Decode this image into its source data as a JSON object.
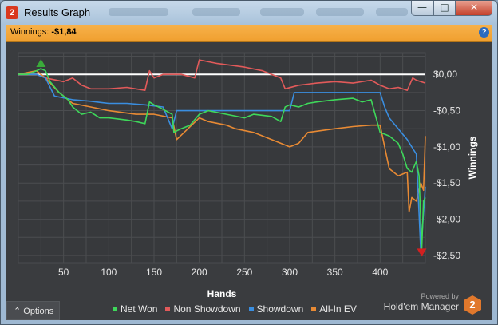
{
  "window": {
    "title": "Results Graph",
    "app_icon": "2",
    "controls": {
      "minimize": "—",
      "maximize": "□",
      "close": "✕"
    }
  },
  "winnings": {
    "label": "Winnings:",
    "value": "-$1,84",
    "help": "?"
  },
  "options": {
    "label": "Options",
    "arrow": "⌃"
  },
  "branding": {
    "powered_by": "Powered by",
    "name": "Hold'em Manager",
    "logo": "2"
  },
  "colors": {
    "net_won": "#3ed85a",
    "non_showdown": "#e25a5a",
    "showdown": "#3a8ee0",
    "allin_ev": "#e88a34",
    "zero_line": "#ffffff"
  },
  "chart_data": {
    "type": "line",
    "xlabel": "Hands",
    "ylabel": "Winnings",
    "xlim": [
      0,
      450
    ],
    "ylim": [
      -2.6,
      0.3
    ],
    "x_ticks": [
      "50",
      "100",
      "150",
      "200",
      "250",
      "300",
      "350",
      "400"
    ],
    "x_tick_values": [
      50,
      100,
      150,
      200,
      250,
      300,
      350,
      400
    ],
    "y_ticks": [
      "$0,00",
      "-$0,50",
      "-$1,00",
      "-$1,50",
      "-$2,00",
      "-$2,50"
    ],
    "y_tick_values": [
      0,
      -0.5,
      -1,
      -1.5,
      -2,
      -2.5
    ],
    "grid": true,
    "legend_position": "bottom",
    "series": [
      {
        "name": "Net Won",
        "color_key": "net_won",
        "x": [
          0,
          10,
          20,
          25,
          30,
          35,
          45,
          55,
          60,
          70,
          80,
          90,
          100,
          120,
          130,
          140,
          145,
          150,
          155,
          170,
          172,
          175,
          180,
          190,
          200,
          210,
          230,
          250,
          260,
          280,
          290,
          295,
          300,
          310,
          320,
          330,
          350,
          370,
          380,
          390,
          400,
          410,
          420,
          425,
          430,
          435,
          440,
          443,
          446,
          448,
          450
        ],
        "y": [
          0,
          0,
          0.05,
          0.08,
          0.05,
          -0.1,
          -0.25,
          -0.35,
          -0.45,
          -0.55,
          -0.52,
          -0.6,
          -0.6,
          -0.63,
          -0.65,
          -0.68,
          -0.38,
          -0.42,
          -0.45,
          -0.55,
          -0.8,
          -0.78,
          -0.75,
          -0.7,
          -0.55,
          -0.5,
          -0.55,
          -0.6,
          -0.55,
          -0.58,
          -0.65,
          -0.45,
          -0.42,
          -0.45,
          -0.4,
          -0.38,
          -0.35,
          -0.33,
          -0.38,
          -0.35,
          -0.8,
          -0.85,
          -0.95,
          -1.1,
          -1.3,
          -1.35,
          -1.2,
          -1.4,
          -2.4,
          -1.75,
          -1.7
        ]
      },
      {
        "name": "Non Showdown",
        "color_key": "non_showdown",
        "x": [
          0,
          20,
          30,
          50,
          60,
          70,
          80,
          100,
          120,
          140,
          145,
          150,
          160,
          180,
          195,
          200,
          220,
          250,
          270,
          290,
          295,
          310,
          330,
          350,
          370,
          390,
          400,
          410,
          420,
          430,
          436,
          440,
          445,
          450
        ],
        "y": [
          0,
          0,
          -0.05,
          -0.1,
          -0.05,
          -0.15,
          -0.2,
          -0.2,
          -0.18,
          -0.22,
          0.05,
          -0.05,
          0,
          0,
          -0.05,
          0.2,
          0.15,
          0.1,
          0.05,
          -0.05,
          -0.2,
          -0.15,
          -0.12,
          -0.1,
          -0.12,
          -0.08,
          -0.15,
          -0.2,
          -0.18,
          -0.22,
          -0.05,
          -0.08,
          -0.1,
          -0.12
        ]
      },
      {
        "name": "Showdown",
        "color_key": "showdown",
        "x": [
          0,
          20,
          30,
          40,
          60,
          80,
          100,
          120,
          140,
          160,
          170,
          175,
          200,
          220,
          250,
          280,
          300,
          305,
          320,
          350,
          380,
          400,
          405,
          410,
          420,
          430,
          440,
          445,
          450
        ],
        "y": [
          0,
          0,
          -0.05,
          -0.3,
          -0.35,
          -0.37,
          -0.4,
          -0.4,
          -0.42,
          -0.45,
          -0.75,
          -0.5,
          -0.5,
          -0.5,
          -0.5,
          -0.5,
          -0.5,
          -0.25,
          -0.25,
          -0.25,
          -0.25,
          -0.25,
          -0.45,
          -0.6,
          -0.75,
          -0.9,
          -1.1,
          -2.45,
          -1.55
        ]
      },
      {
        "name": "All-In EV",
        "color_key": "allin_ev",
        "x": [
          0,
          20,
          30,
          45,
          60,
          80,
          100,
          130,
          150,
          170,
          175,
          200,
          210,
          230,
          240,
          260,
          280,
          300,
          310,
          320,
          350,
          370,
          390,
          400,
          405,
          410,
          420,
          430,
          432,
          435,
          440,
          445,
          448,
          450
        ],
        "y": [
          0,
          0.05,
          -0.05,
          -0.25,
          -0.4,
          -0.45,
          -0.5,
          -0.55,
          -0.55,
          -0.6,
          -0.9,
          -0.6,
          -0.65,
          -0.7,
          -0.75,
          -0.8,
          -0.9,
          -1.0,
          -0.95,
          -0.8,
          -0.75,
          -0.72,
          -0.7,
          -0.7,
          -1.0,
          -1.3,
          -1.4,
          -1.35,
          -1.9,
          -1.7,
          -1.75,
          -1.5,
          -1.6,
          -0.85
        ]
      }
    ],
    "markers": [
      {
        "shape": "triangle-up",
        "color": "#3aaa3a",
        "x": 25,
        "y": 0.08
      },
      {
        "shape": "triangle-down",
        "color": "#d22020",
        "x": 446,
        "y": -2.45
      }
    ]
  }
}
